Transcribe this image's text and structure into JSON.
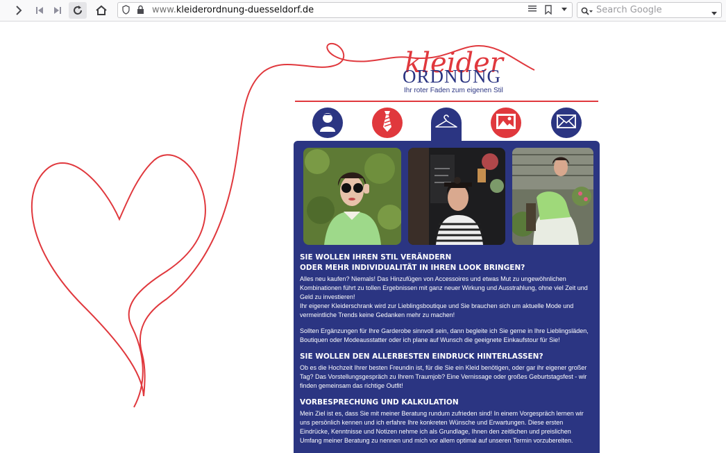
{
  "browser": {
    "url_domain": "kleiderordnung-duesseldorf.de",
    "url_prefix": "www.",
    "search_placeholder": "Search Google"
  },
  "logo": {
    "word1": "kleider",
    "word2": "ORDNUNG",
    "tagline": "Ihr roter Faden zum eigenen Stil"
  },
  "nav": [
    {
      "icon": "person-icon",
      "color": "#2b3582"
    },
    {
      "icon": "tie-icon",
      "color": "#e0383d"
    },
    {
      "icon": "hanger-icon",
      "color": "#2b3582",
      "active": true
    },
    {
      "icon": "image-icon",
      "color": "#e0383d"
    },
    {
      "icon": "envelope-icon",
      "color": "#2b3582"
    }
  ],
  "sections": {
    "s1_heading_line1": "SIE WOLLEN IHREN STIL VERÄNDERN",
    "s1_heading_line2": "ODER MEHR INDIVIDUALITÄT IN IHREN LOOK BRINGEN?",
    "s1_p1": "Alles neu kaufen? Niemals! Das Hinzufügen von Accessoires und etwas Mut zu ungewöhnlichen Kombinationen führt zu tollen Ergebnissen mit ganz neuer Wirkung und Ausstrahlung, ohne viel Zeit und Geld zu investieren!",
    "s1_p2": "Ihr eigener Kleiderschrank wird zur Lieblingsboutique und Sie brauchen sich um aktuelle Mode und vermeintliche Trends keine Gedanken mehr zu machen!",
    "s1_p3": "Sollten Ergänzungen für Ihre Garderobe sinnvoll sein, dann begleite ich Sie gerne in Ihre Lieblingsläden, Boutiquen oder Modeausstatter oder ich plane auf Wunsch die geeignete Einkaufstour für Sie!",
    "s2_heading": "SIE WOLLEN DEN ALLERBESTEN EINDRUCK HINTERLASSEN?",
    "s2_p1": "Ob es die Hochzeit Ihrer besten Freundin ist, für die Sie ein Kleid benötigen, oder gar ihr eigener großer Tag? Das Vorstellungsgespräch zu Ihrem Traumjob? Eine Vernissage oder großes Geburtstagsfest - wir finden gemeinsam das richtige Outfit!",
    "s3_heading": "VORBESPRECHUNG UND KALKULATION",
    "s3_p1": "Mein Ziel ist es, dass Sie mit meiner Beratung rundum zufrieden sind! In einem Vorgespräch lernen wir uns persönlich kennen und ich erfahre Ihre konkreten Wünsche und Erwartungen. Diese ersten Eindrücke, Kenntnisse und Notizen nehme ich als Grundlage, Ihnen den zeitlichen und preislichen Umfang meiner Beratung zu nennen und mich vor allem optimal auf unseren Termin vorzubereiten."
  },
  "colors": {
    "brand_blue": "#2b3582",
    "brand_red": "#e0383d"
  }
}
